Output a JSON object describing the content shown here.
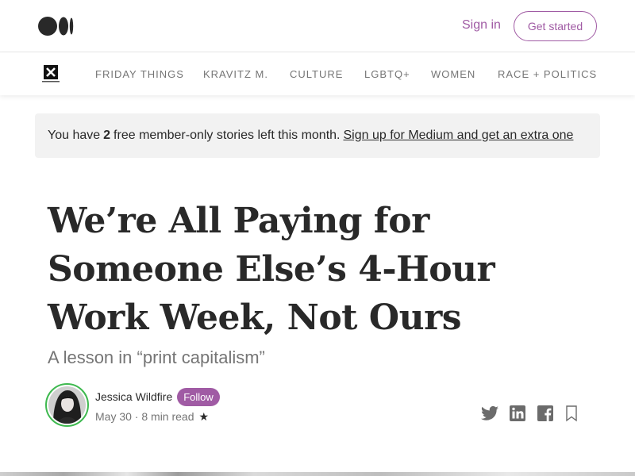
{
  "header": {
    "logo_icon": "medium-logo-icon",
    "signin_label": "Sign in",
    "getstarted_label": "Get started",
    "accent_color": "#a05ba4"
  },
  "publication": {
    "logo_icon": "publication-x-logo-icon",
    "nav": [
      "FRIDAY THINGS",
      "KRAVITZ M.",
      "CULTURE",
      "LGBTQ+",
      "WOMEN",
      "RACE + POLITICS"
    ]
  },
  "banner": {
    "prefix": "You have",
    "count": "2",
    "suffix": "free member-only stories left this month.",
    "link": "Sign up for Medium and get an extra one"
  },
  "article": {
    "title": "We’re All Paying for Someone Else’s 4-Hour Work Week, Not Ours",
    "subtitle": "A lesson in “print capitalism”",
    "author": "Jessica Wildfire",
    "follow_label": "Follow",
    "meta": "May 30 · 8 min read",
    "member_star": "★"
  },
  "share_icons": [
    "twitter-icon",
    "linkedin-icon",
    "facebook-icon",
    "bookmark-icon"
  ]
}
